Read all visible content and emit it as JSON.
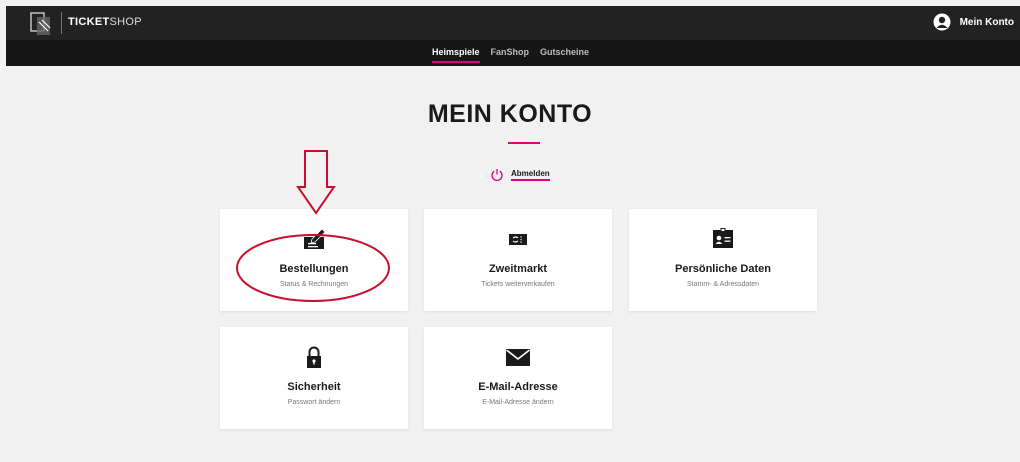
{
  "brand": {
    "bold": "TICKET",
    "light": "SHOP"
  },
  "account": {
    "label": "Mein Konto"
  },
  "nav": [
    {
      "label": "Heimspiele",
      "active": true
    },
    {
      "label": "FanShop",
      "active": false
    },
    {
      "label": "Gutscheine",
      "active": false
    }
  ],
  "page": {
    "title": "MEIN KONTO",
    "logout_label": "Abmelden"
  },
  "cards": [
    {
      "title": "Bestellungen",
      "subtitle": "Status & Rechnungen",
      "icon": "order-pen-icon"
    },
    {
      "title": "Zweitmarkt",
      "subtitle": "Tickets weiterverkaufen",
      "icon": "ticket-resale-icon"
    },
    {
      "title": "Persönliche Daten",
      "subtitle": "Stamm- & Adressdaten",
      "icon": "id-card-icon"
    },
    {
      "title": "Sicherheit",
      "subtitle": "Passwort ändern",
      "icon": "lock-icon"
    },
    {
      "title": "E-Mail-Adresse",
      "subtitle": "E-Mail-Adresse ändern",
      "icon": "envelope-icon"
    }
  ],
  "colors": {
    "accent": "#e2007a",
    "topbar": "#222222",
    "annotation": "#c8102e"
  }
}
